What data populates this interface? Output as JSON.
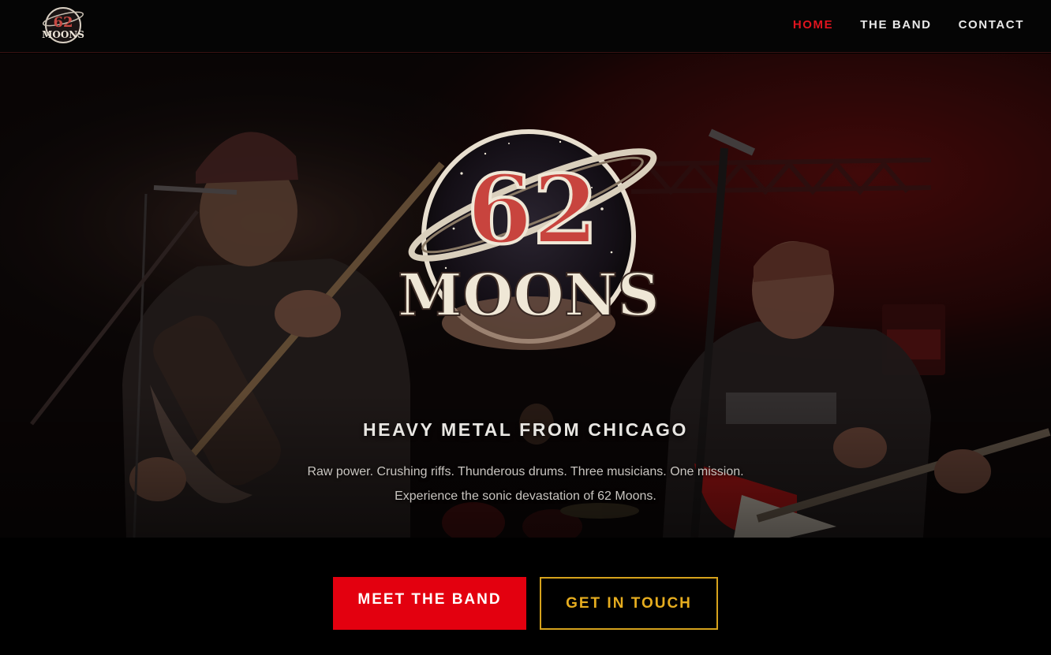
{
  "brand": {
    "logo_line1": "62",
    "logo_line2": "MOONS",
    "accent_red": "#e3000f",
    "accent_gold": "#d6a21c"
  },
  "nav": {
    "items": [
      {
        "label": "HOME",
        "active": true
      },
      {
        "label": "THE BAND",
        "active": false
      },
      {
        "label": "CONTACT",
        "active": false
      }
    ]
  },
  "hero": {
    "logo_number": "62",
    "logo_word": "MOONS",
    "background_photo_icon": "band-stage-photo",
    "tagline": "HEAVY METAL FROM CHICAGO",
    "description_line1": "Raw power. Crushing riffs. Thunderous drums. Three musicians. One mission.",
    "description_line2": "Experience the sonic devastation of 62 Moons."
  },
  "cta": {
    "primary_label": "MEET THE BAND",
    "secondary_label": "GET IN TOUCH"
  }
}
